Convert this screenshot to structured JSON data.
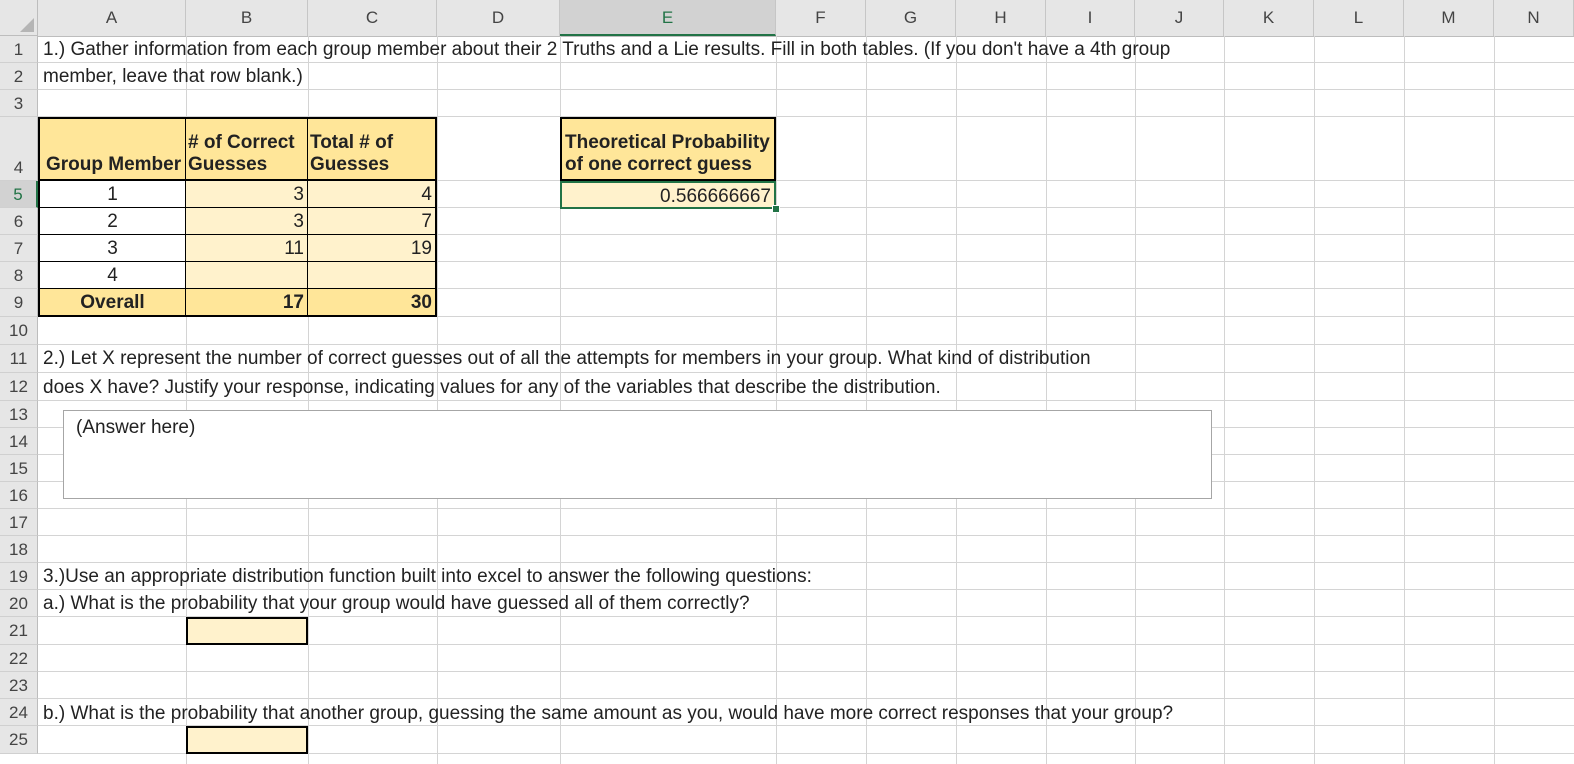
{
  "columns": [
    "A",
    "B",
    "C",
    "D",
    "E",
    "F",
    "G",
    "H",
    "I",
    "J",
    "K",
    "L",
    "M",
    "N"
  ],
  "selected_column": "E",
  "rows": [
    "1",
    "2",
    "3",
    "4",
    "5",
    "6",
    "7",
    "8",
    "9",
    "10",
    "11",
    "12",
    "13",
    "14",
    "15",
    "16",
    "17",
    "18",
    "19",
    "20",
    "21",
    "22",
    "23",
    "24",
    "25"
  ],
  "selected_row": "5",
  "q1": {
    "line1": "1.) Gather information from each group member about their 2 Truths and a Lie results.  Fill in both tables.  (If you don't have a 4th group",
    "line2": "member, leave that row blank.)"
  },
  "table": {
    "header_member": "Group Member",
    "header_correct_1": "# of Correct",
    "header_correct_2": "Guesses",
    "header_total_1": "Total # of",
    "header_total_2": "Guesses",
    "rows": [
      {
        "member": "1",
        "correct": "3",
        "total": "4"
      },
      {
        "member": "2",
        "correct": "3",
        "total": "7"
      },
      {
        "member": "3",
        "correct": "11",
        "total": "19"
      },
      {
        "member": "4",
        "correct": "",
        "total": ""
      }
    ],
    "overall_label": "Overall",
    "overall_correct": "17",
    "overall_total": "30"
  },
  "theoretical": {
    "header_1": "Theoretical Probability",
    "header_2": "of one correct guess",
    "value": "0.566666667"
  },
  "q2": {
    "line1": "2.) Let X represent the number of correct guesses out of all the attempts for members in your group.  What kind of distribution",
    "line2": "does X have?  Justify your response, indicating values for any of the variables that describe the distribution.",
    "answer_placeholder": "(Answer here)"
  },
  "q3": {
    "intro": "3.)Use an appropriate distribution function built into excel to answer the following questions:",
    "a": "a.) What is the probability that your group would have guessed all of them correctly?",
    "a_answer": "",
    "b": "b.) What is the probability that another group, guessing the same amount as you, would have more correct responses that your group?",
    "b_answer": ""
  },
  "colors": {
    "header_fill": "#ffe699",
    "input_fill": "#fff2cc",
    "selection_accent": "#217346"
  }
}
